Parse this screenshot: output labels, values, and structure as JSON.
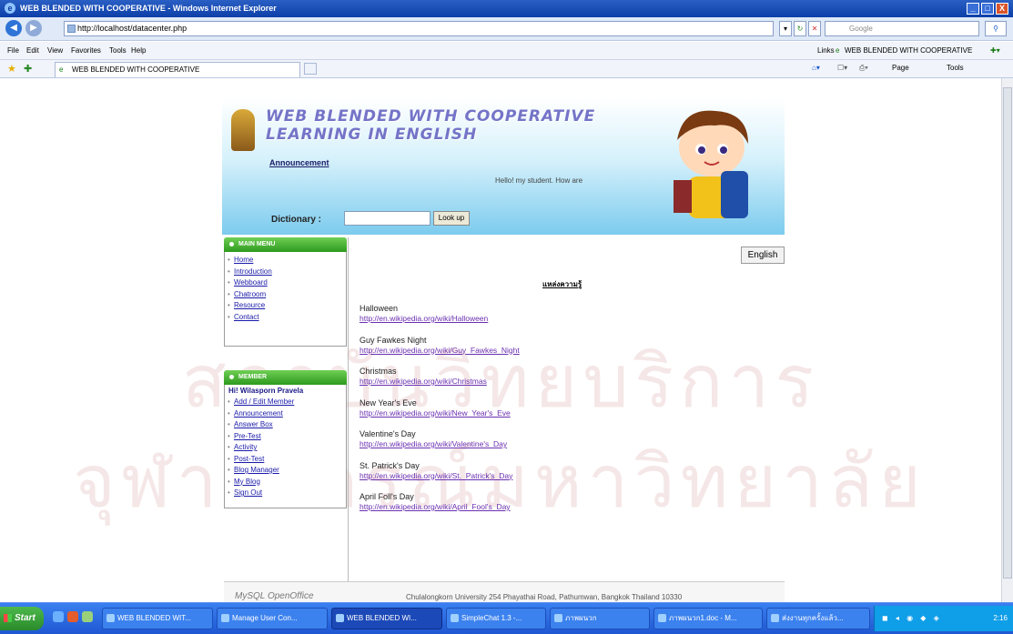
{
  "window": {
    "title": "WEB BLENDED WITH COOPERATIVE - Windows Internet Explorer",
    "controls": [
      "_",
      "□",
      "X"
    ]
  },
  "address": {
    "url": "http://localhost/datacenter.php",
    "search_placeholder": "Google"
  },
  "menu": {
    "items": [
      "File",
      "Edit",
      "View",
      "Favorites",
      "Tools",
      "Help"
    ],
    "links_label": "Links",
    "links_value": "WEB BLENDED WITH COOPERATIVE"
  },
  "tab": {
    "label": "WEB BLENDED WITH COOPERATIVE",
    "page_label": "Page",
    "tools_label": "Tools"
  },
  "banner": {
    "title_line1": "WEB BLENDED WITH COOPERATIVE",
    "title_line2": "LEARNING IN ENGLISH",
    "announcement": "Announcement",
    "hello": "Hello! my student. How are",
    "dict_label": "Dictionary :",
    "dict_value": "",
    "lookup_label": "Look up"
  },
  "mainmenu": {
    "header": "MAIN MENU",
    "items": [
      "Home",
      "Introduction",
      "Webboard",
      "Chatroom",
      "Resource",
      "Contact"
    ]
  },
  "membermenu": {
    "header": "MEMBER",
    "user": "Hi! Wilasporn Pravela",
    "items": [
      "Add / Edit Member",
      "Announcement",
      "Answer Box",
      "Pre-Test",
      "Activity",
      "Post-Test",
      "Blog Manager",
      "My Blog",
      "Sign Out"
    ]
  },
  "main": {
    "lang_button": "English",
    "heading": "แหล่งความรู้",
    "links": [
      {
        "title": "Halloween",
        "url": "http://en.wikipedia.org/wiki/Halloween"
      },
      {
        "title": "Guy Fawkes Night",
        "url": "http://en.wikipedia.org/wiki/Guy_Fawkes_Night"
      },
      {
        "title": "Christmas",
        "url": "http://en.wikipedia.org/wiki/Christmas"
      },
      {
        "title": "New Year's Eve",
        "url": "http://en.wikipedia.org/wiki/New_Year's_Eve"
      },
      {
        "title": "Valentine's Day",
        "url": "http://en.wikipedia.org/wiki/Valentine's_Day"
      },
      {
        "title": "St. Patrick's Day",
        "url": "http://en.wikipedia.org/wiki/St._Patrick's_Day"
      },
      {
        "title": "April Foll's Day",
        "url": "http://en.wikipedia.org/wiki/April_Fool's_Day"
      }
    ]
  },
  "footer": {
    "logo_text": "MySQL  OpenOffice",
    "address": "Chulalongkorn University 254 Phayathai Road, Pathumwan, Bangkok Thailand 10330"
  },
  "watermark": {
    "line1": "สถาบันวิทยบริการ",
    "line2": "จุฬาลงกรณ์มหาวิทยาลัย"
  },
  "taskbar": {
    "start": "Start",
    "buttons": [
      "WEB BLENDED WIT...",
      "Manage User Con...",
      "WEB BLENDED WI...",
      "SimpleChat 1.3 -...",
      "ภาพผนวก",
      "ภาพผนวก1.doc - M...",
      "ส่งงานทุกครั้งแล้ว..."
    ],
    "clock": "2:16"
  }
}
